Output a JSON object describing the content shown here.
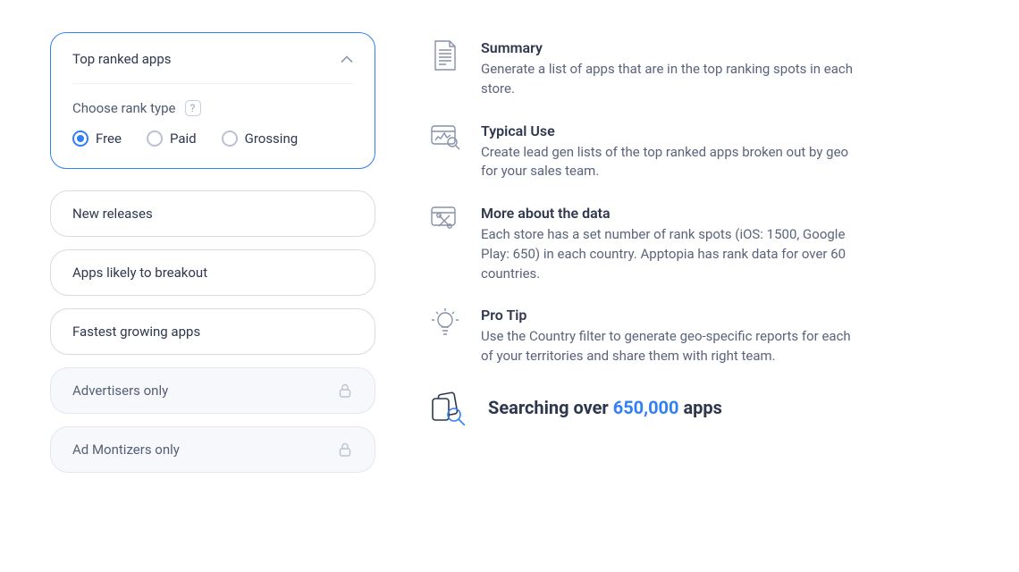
{
  "left": {
    "expanded": {
      "title": "Top ranked apps",
      "sublabel": "Choose rank type",
      "options": [
        "Free",
        "Paid",
        "Grossing"
      ],
      "selected": "Free"
    },
    "cards": [
      {
        "label": "New releases",
        "locked": false
      },
      {
        "label": "Apps likely to breakout",
        "locked": false
      },
      {
        "label": "Fastest growing apps",
        "locked": false
      },
      {
        "label": "Advertisers only",
        "locked": true
      },
      {
        "label": "Ad Montizers only",
        "locked": true
      }
    ]
  },
  "right": {
    "blocks": [
      {
        "icon": "document",
        "title": "Summary",
        "body": "Generate a list of apps that are in the top ranking spots in each store."
      },
      {
        "icon": "chart",
        "title": "Typical Use",
        "body": "Create lead gen lists of the top ranked apps broken out by geo for your sales team."
      },
      {
        "icon": "tools",
        "title": "More about the data",
        "body": "Each store has a set number of rank spots (iOS: 1500, Google Play: 650) in each country. Apptopia has rank data for over 60 countries."
      },
      {
        "icon": "bulb",
        "title": "Pro Tip",
        "body": "Use the Country filter to generate geo-specific reports for each of your territories and share them with right team."
      }
    ],
    "search": {
      "prefix": "Searching over ",
      "count": "650,000",
      "suffix": " apps"
    }
  },
  "colors": {
    "accent": "#317ff5"
  }
}
